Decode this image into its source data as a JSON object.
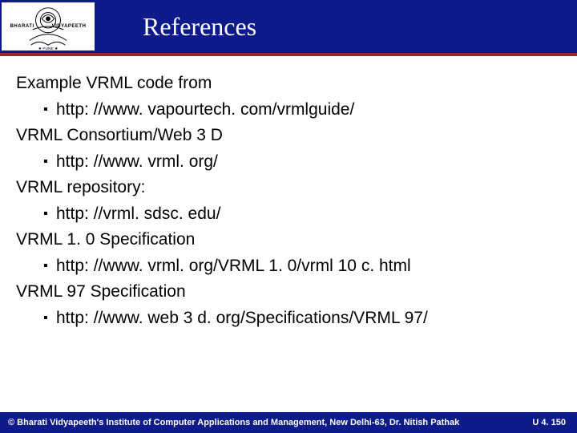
{
  "header": {
    "title": "References",
    "logo_left": "BHARATI",
    "logo_right": "VIDYAPEETH"
  },
  "references": [
    {
      "label": "Example VRML code from",
      "url": "http: //www. vapourtech. com/vrmlguide/"
    },
    {
      "label": "VRML Consortium/Web 3 D",
      "url": "http: //www. vrml. org/"
    },
    {
      "label": "VRML repository:",
      "url": "http: //vrml. sdsc. edu/"
    },
    {
      "label": "VRML 1. 0 Specification",
      "url": "http: //www. vrml. org/VRML 1. 0/vrml 10 c. html"
    },
    {
      "label": "VRML 97 Specification",
      "url": "http: //www. web 3 d. org/Specifications/VRML 97/"
    }
  ],
  "footer": {
    "left": "© Bharati Vidyapeeth's Institute of Computer Applications and Management, New Delhi-63, Dr. Nitish Pathak",
    "right": "U 4. 150"
  }
}
